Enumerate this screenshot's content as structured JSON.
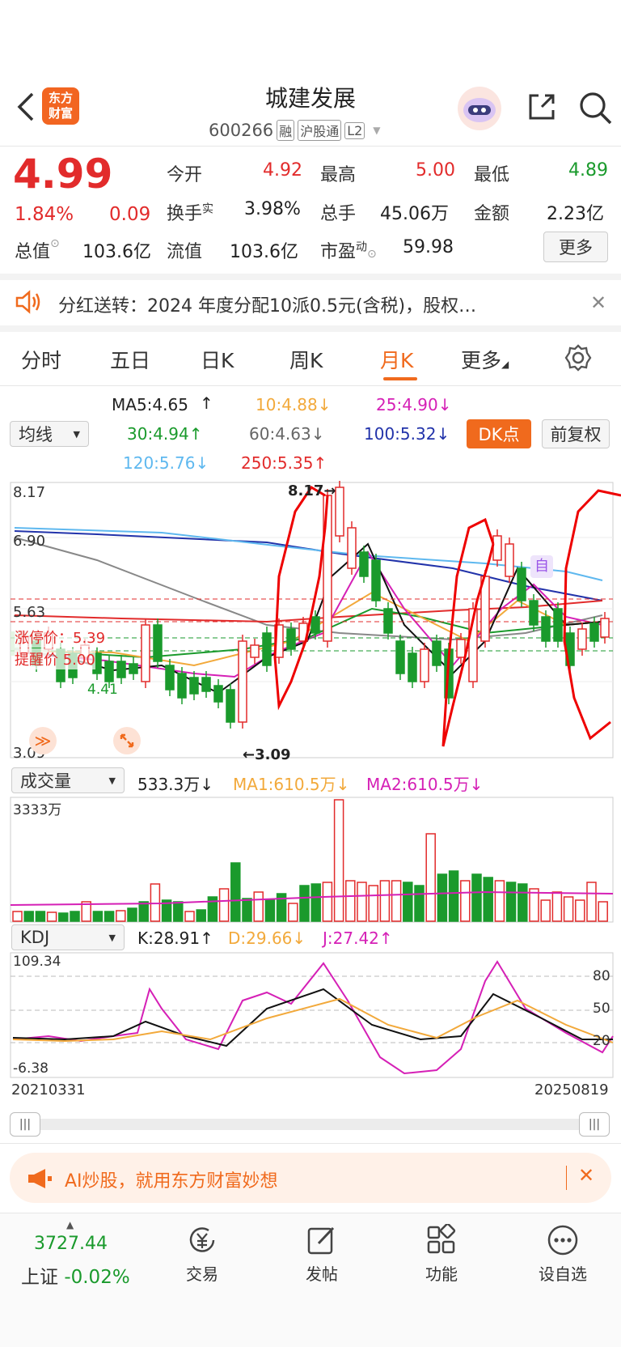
{
  "header": {
    "title": "城建发展",
    "code": "600266",
    "tags": [
      "融",
      "沪股通",
      "L2"
    ],
    "logo_text_1": "东方",
    "logo_text_2": "财富"
  },
  "quote": {
    "price": "4.99",
    "change_pct": "1.84%",
    "change_amt": "0.09",
    "open_label": "今开",
    "open": "4.92",
    "high_label": "最高",
    "high": "5.00",
    "low_label": "最低",
    "low": "4.89",
    "turnover_label": "换手",
    "turnover_sup": "实",
    "turnover": "3.98%",
    "volume_label": "总手",
    "volume": "45.06万",
    "amount_label": "金额",
    "amount": "2.23亿",
    "mktcap_label": "总值",
    "mktcap": "103.6亿",
    "float_label": "流值",
    "float": "103.6亿",
    "pe_label": "市盈",
    "pe_sup": "动",
    "pe": "59.98",
    "more_btn": "更多"
  },
  "notice": {
    "text": "分红送转：2024 年度分配10派0.5元(含税)，股权…"
  },
  "tabs": [
    "分时",
    "五日",
    "日K",
    "周K",
    "月K",
    "更多"
  ],
  "active_tab": "月K",
  "ma_panel": {
    "selector": "均线",
    "ma5": "MA5:4.65",
    "ma10": "10:4.88",
    "ma25": "25:4.90",
    "ma30": "30:4.94",
    "ma60": "60:4.63",
    "ma100": "100:5.32",
    "ma120": "120:5.76",
    "ma250": "250:5.35",
    "dk_btn": "DK点",
    "fq_btn": "前复权"
  },
  "kline": {
    "y_top": "8.17",
    "y_mid": "6.90",
    "y_low": "5.63",
    "y_bottom": "3.09",
    "limit_up": "涨停价：5.39",
    "remind": "提醒价 5.00",
    "max_label": "8.17",
    "min_label": "3.09",
    "price_box": "4.41",
    "zi": "自"
  },
  "volume": {
    "selector": "成交量",
    "vol": "533.3万",
    "ma1": "MA1:610.5万",
    "ma2": "MA2:610.5万",
    "y_top": "3333万"
  },
  "kdj": {
    "selector": "KDJ",
    "k": "K:28.91",
    "d": "D:29.66",
    "j": "J:27.42",
    "y_top": "109.34",
    "y_bottom": "-6.38",
    "lvl80": "80",
    "lvl50": "50",
    "lvl20": "20"
  },
  "date_start": "20210331",
  "date_end": "20250819",
  "ad": {
    "text": "AI炒股，就用东方财富妙想"
  },
  "bottom_nav": {
    "index_value": "3727.44",
    "index_name": "上证",
    "index_change": "-0.02%",
    "trade": "交易",
    "post": "发帖",
    "func": "功能",
    "watch": "设自选"
  },
  "colors": {
    "up": "#e22b2b",
    "down": "#1a9a2c",
    "accent": "#f06a1d"
  }
}
